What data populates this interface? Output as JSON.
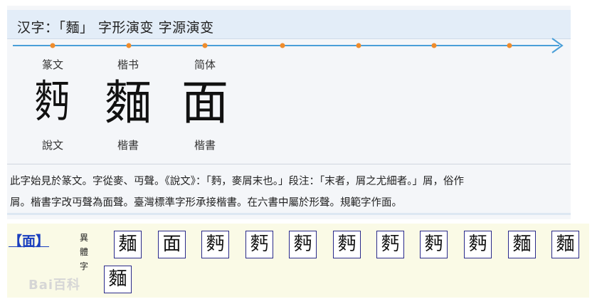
{
  "header": {
    "title": "汉字：「麵」 字形演变 字源演变"
  },
  "timeline": {
    "accent": "#4a9fd8",
    "dot_color": "#f08c2b"
  },
  "stages": [
    {
      "top_label": "篆文",
      "glyph": "麪",
      "source": "說文"
    },
    {
      "top_label": "楷书",
      "glyph": "麵",
      "source": "楷書"
    },
    {
      "top_label": "简体",
      "glyph": "面",
      "source": "楷書"
    }
  ],
  "description": {
    "line1": "此字始見於篆文。字從麥、丏聲。《說文》：「麪，麥屑末也。」段注：「末者，屑之尤細者。」屑，俗作",
    "line2": "屑。楷書字改丏聲為面聲。臺灣標準字形承接楷書。在六書中屬於形聲。規範字作面。"
  },
  "variants": {
    "link_text": "【面】",
    "label": [
      "異",
      "體",
      "字"
    ],
    "chars": [
      "麺",
      "面",
      "麪",
      "麫",
      "麪",
      "麪",
      "麫",
      "麪",
      "麪",
      "麵",
      "麵",
      "麵"
    ]
  },
  "watermark": "Bai百科"
}
